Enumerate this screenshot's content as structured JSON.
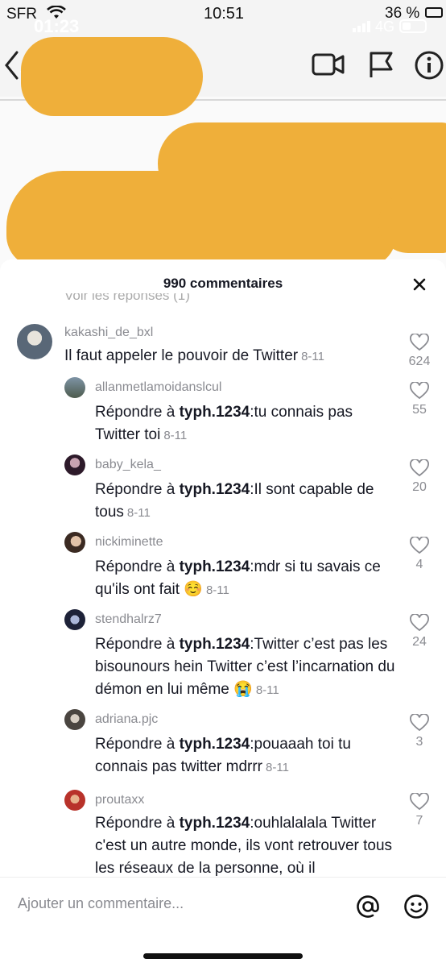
{
  "outer_status": {
    "carrier": "SFR",
    "time": "10:51",
    "battery": "36 %"
  },
  "inner_status": {
    "time": "01:23",
    "network": "4G"
  },
  "nav": {
    "back_icon": "chevron-left-icon",
    "video_icon": "video-camera-icon",
    "flag_icon": "flag-icon",
    "info_icon": "info-icon"
  },
  "sheet": {
    "title": "990 commentaires",
    "close_icon": "close-icon"
  },
  "faded_reply_link": "Voir les réponses (1)",
  "comments": [
    {
      "username": "kakashi_de_bxl",
      "text": "Il faut appeler le pouvoir de Twitter",
      "date": "8-11",
      "likes": "624"
    },
    {
      "username": "allanmetlamoidanslcul",
      "prefix": "Répondre à ",
      "mention": "typh.1234",
      "text": ":tu connais pas Twitter toi",
      "date": "8-11",
      "likes": "55"
    },
    {
      "username": "baby_kela_",
      "prefix": "Répondre à ",
      "mention": "typh.1234",
      "text": ":Il sont capable de tous",
      "date": "8-11",
      "likes": "20"
    },
    {
      "username": "nickiminette",
      "prefix": "Répondre à ",
      "mention": "typh.1234",
      "text": ":mdr si tu savais ce qu'ils ont fait ☺️",
      "date": "8-11",
      "likes": "4"
    },
    {
      "username": "stendhalrz7",
      "prefix": "Répondre à ",
      "mention": "typh.1234",
      "text": ":Twitter c’est pas les bisounours hein Twitter c’est l’incarnation du démon en lui même 😭",
      "date": "8-11",
      "likes": "24"
    },
    {
      "username": "adriana.pjc",
      "prefix": "Répondre à ",
      "mention": "typh.1234",
      "text": ":pouaaah toi tu connais pas twitter mdrrr",
      "date": "8-11",
      "likes": "3"
    },
    {
      "username": "proutaxx",
      "prefix": "Répondre à ",
      "mention": "typh.1234",
      "text": ":ouhlalalala Twitter c'est un autre monde, ils vont retrouver tous les réseaux de la personne, où il",
      "date": "",
      "likes": "7"
    }
  ],
  "input": {
    "placeholder": "Ajouter un commentaire...",
    "at_icon": "at-sign-icon",
    "emoji_icon": "smiley-icon"
  },
  "colors": {
    "redaction": "#EFAF3A",
    "text": "#161823",
    "secondary": "#8a8b91"
  }
}
